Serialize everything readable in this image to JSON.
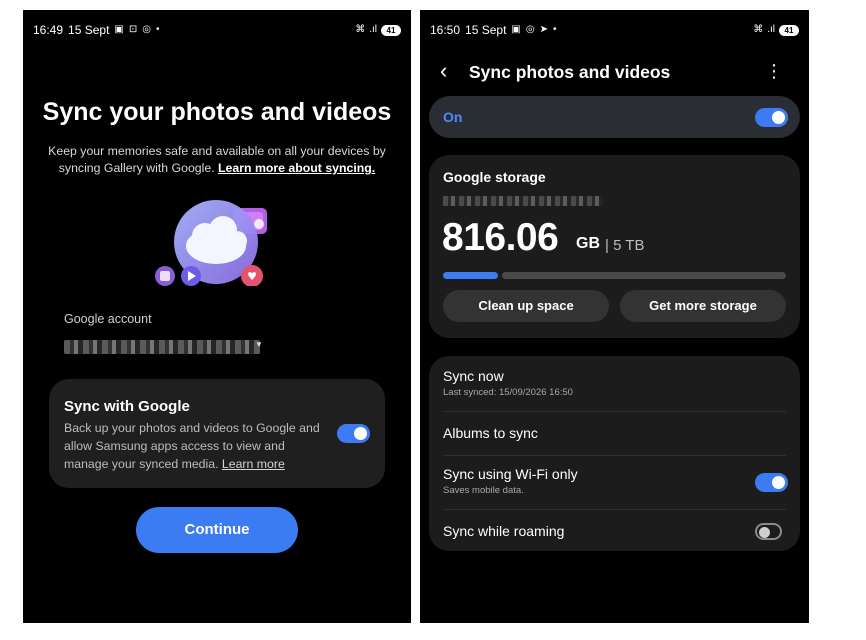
{
  "left": {
    "status": {
      "time": "16:49",
      "date": "15 Sept",
      "battery": "41"
    },
    "title": "Sync your photos and videos",
    "subtitle": "Keep your memories safe and available on all your devices by syncing Gallery with Google.",
    "subtitle_link": "Learn more about syncing.",
    "account_label": "Google account",
    "sync_card": {
      "title": "Sync with Google",
      "description": "Back up your photos and videos to Google and allow Samsung apps access to view and manage your synced media.",
      "learn_more": "Learn more",
      "toggle_on": true
    },
    "continue_label": "Continue"
  },
  "right": {
    "status": {
      "time": "16:50",
      "date": "15 Sept",
      "battery": "41"
    },
    "title": "Sync photos and videos",
    "on_label": "On",
    "storage": {
      "title": "Google storage",
      "used": "816.06",
      "unit": "GB",
      "total": "| 5 TB",
      "used_fraction": 0.16,
      "clean_label": "Clean up space",
      "get_more_label": "Get more storage"
    },
    "settings": {
      "sync_now": {
        "title": "Sync now",
        "sub": "Last synced: 15/09/2026 16:50"
      },
      "albums": {
        "title": "Albums to sync"
      },
      "wifi_only": {
        "title": "Sync using Wi-Fi only",
        "sub": "Saves mobile data.",
        "toggle_on": true
      },
      "roaming": {
        "title": "Sync while roaming",
        "toggle_on": false
      }
    }
  },
  "colors": {
    "accent": "#3b7cf2",
    "background": "#000000",
    "card": "#1f1f1f"
  }
}
